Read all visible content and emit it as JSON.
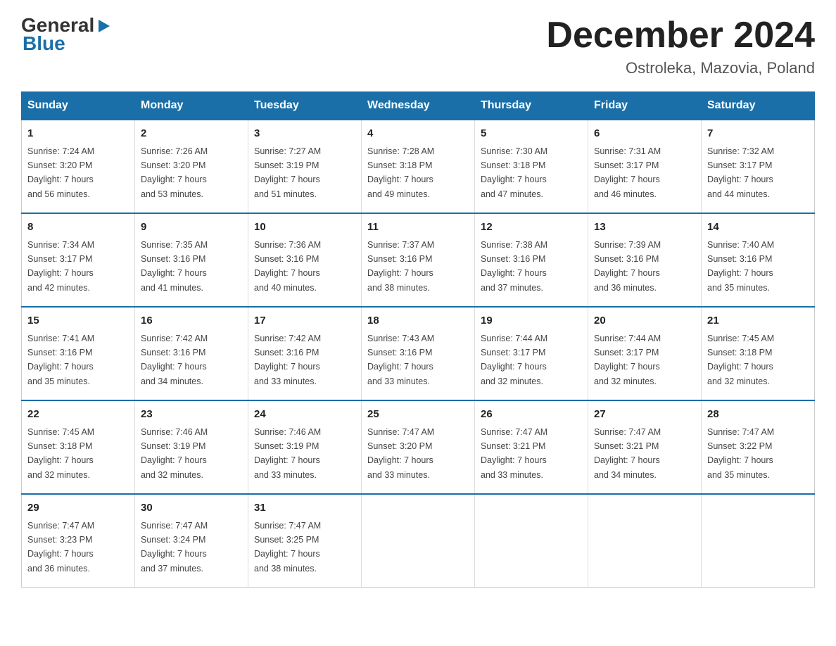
{
  "logo": {
    "general": "General",
    "blue": "Blue",
    "arrow": "▶"
  },
  "title": {
    "month_year": "December 2024",
    "location": "Ostroleka, Mazovia, Poland"
  },
  "columns": [
    "Sunday",
    "Monday",
    "Tuesday",
    "Wednesday",
    "Thursday",
    "Friday",
    "Saturday"
  ],
  "weeks": [
    [
      {
        "day": "1",
        "sunrise": "Sunrise: 7:24 AM",
        "sunset": "Sunset: 3:20 PM",
        "daylight": "Daylight: 7 hours",
        "minutes": "and 56 minutes."
      },
      {
        "day": "2",
        "sunrise": "Sunrise: 7:26 AM",
        "sunset": "Sunset: 3:20 PM",
        "daylight": "Daylight: 7 hours",
        "minutes": "and 53 minutes."
      },
      {
        "day": "3",
        "sunrise": "Sunrise: 7:27 AM",
        "sunset": "Sunset: 3:19 PM",
        "daylight": "Daylight: 7 hours",
        "minutes": "and 51 minutes."
      },
      {
        "day": "4",
        "sunrise": "Sunrise: 7:28 AM",
        "sunset": "Sunset: 3:18 PM",
        "daylight": "Daylight: 7 hours",
        "minutes": "and 49 minutes."
      },
      {
        "day": "5",
        "sunrise": "Sunrise: 7:30 AM",
        "sunset": "Sunset: 3:18 PM",
        "daylight": "Daylight: 7 hours",
        "minutes": "and 47 minutes."
      },
      {
        "day": "6",
        "sunrise": "Sunrise: 7:31 AM",
        "sunset": "Sunset: 3:17 PM",
        "daylight": "Daylight: 7 hours",
        "minutes": "and 46 minutes."
      },
      {
        "day": "7",
        "sunrise": "Sunrise: 7:32 AM",
        "sunset": "Sunset: 3:17 PM",
        "daylight": "Daylight: 7 hours",
        "minutes": "and 44 minutes."
      }
    ],
    [
      {
        "day": "8",
        "sunrise": "Sunrise: 7:34 AM",
        "sunset": "Sunset: 3:17 PM",
        "daylight": "Daylight: 7 hours",
        "minutes": "and 42 minutes."
      },
      {
        "day": "9",
        "sunrise": "Sunrise: 7:35 AM",
        "sunset": "Sunset: 3:16 PM",
        "daylight": "Daylight: 7 hours",
        "minutes": "and 41 minutes."
      },
      {
        "day": "10",
        "sunrise": "Sunrise: 7:36 AM",
        "sunset": "Sunset: 3:16 PM",
        "daylight": "Daylight: 7 hours",
        "minutes": "and 40 minutes."
      },
      {
        "day": "11",
        "sunrise": "Sunrise: 7:37 AM",
        "sunset": "Sunset: 3:16 PM",
        "daylight": "Daylight: 7 hours",
        "minutes": "and 38 minutes."
      },
      {
        "day": "12",
        "sunrise": "Sunrise: 7:38 AM",
        "sunset": "Sunset: 3:16 PM",
        "daylight": "Daylight: 7 hours",
        "minutes": "and 37 minutes."
      },
      {
        "day": "13",
        "sunrise": "Sunrise: 7:39 AM",
        "sunset": "Sunset: 3:16 PM",
        "daylight": "Daylight: 7 hours",
        "minutes": "and 36 minutes."
      },
      {
        "day": "14",
        "sunrise": "Sunrise: 7:40 AM",
        "sunset": "Sunset: 3:16 PM",
        "daylight": "Daylight: 7 hours",
        "minutes": "and 35 minutes."
      }
    ],
    [
      {
        "day": "15",
        "sunrise": "Sunrise: 7:41 AM",
        "sunset": "Sunset: 3:16 PM",
        "daylight": "Daylight: 7 hours",
        "minutes": "and 35 minutes."
      },
      {
        "day": "16",
        "sunrise": "Sunrise: 7:42 AM",
        "sunset": "Sunset: 3:16 PM",
        "daylight": "Daylight: 7 hours",
        "minutes": "and 34 minutes."
      },
      {
        "day": "17",
        "sunrise": "Sunrise: 7:42 AM",
        "sunset": "Sunset: 3:16 PM",
        "daylight": "Daylight: 7 hours",
        "minutes": "and 33 minutes."
      },
      {
        "day": "18",
        "sunrise": "Sunrise: 7:43 AM",
        "sunset": "Sunset: 3:16 PM",
        "daylight": "Daylight: 7 hours",
        "minutes": "and 33 minutes."
      },
      {
        "day": "19",
        "sunrise": "Sunrise: 7:44 AM",
        "sunset": "Sunset: 3:17 PM",
        "daylight": "Daylight: 7 hours",
        "minutes": "and 32 minutes."
      },
      {
        "day": "20",
        "sunrise": "Sunrise: 7:44 AM",
        "sunset": "Sunset: 3:17 PM",
        "daylight": "Daylight: 7 hours",
        "minutes": "and 32 minutes."
      },
      {
        "day": "21",
        "sunrise": "Sunrise: 7:45 AM",
        "sunset": "Sunset: 3:18 PM",
        "daylight": "Daylight: 7 hours",
        "minutes": "and 32 minutes."
      }
    ],
    [
      {
        "day": "22",
        "sunrise": "Sunrise: 7:45 AM",
        "sunset": "Sunset: 3:18 PM",
        "daylight": "Daylight: 7 hours",
        "minutes": "and 32 minutes."
      },
      {
        "day": "23",
        "sunrise": "Sunrise: 7:46 AM",
        "sunset": "Sunset: 3:19 PM",
        "daylight": "Daylight: 7 hours",
        "minutes": "and 32 minutes."
      },
      {
        "day": "24",
        "sunrise": "Sunrise: 7:46 AM",
        "sunset": "Sunset: 3:19 PM",
        "daylight": "Daylight: 7 hours",
        "minutes": "and 33 minutes."
      },
      {
        "day": "25",
        "sunrise": "Sunrise: 7:47 AM",
        "sunset": "Sunset: 3:20 PM",
        "daylight": "Daylight: 7 hours",
        "minutes": "and 33 minutes."
      },
      {
        "day": "26",
        "sunrise": "Sunrise: 7:47 AM",
        "sunset": "Sunset: 3:21 PM",
        "daylight": "Daylight: 7 hours",
        "minutes": "and 33 minutes."
      },
      {
        "day": "27",
        "sunrise": "Sunrise: 7:47 AM",
        "sunset": "Sunset: 3:21 PM",
        "daylight": "Daylight: 7 hours",
        "minutes": "and 34 minutes."
      },
      {
        "day": "28",
        "sunrise": "Sunrise: 7:47 AM",
        "sunset": "Sunset: 3:22 PM",
        "daylight": "Daylight: 7 hours",
        "minutes": "and 35 minutes."
      }
    ],
    [
      {
        "day": "29",
        "sunrise": "Sunrise: 7:47 AM",
        "sunset": "Sunset: 3:23 PM",
        "daylight": "Daylight: 7 hours",
        "minutes": "and 36 minutes."
      },
      {
        "day": "30",
        "sunrise": "Sunrise: 7:47 AM",
        "sunset": "Sunset: 3:24 PM",
        "daylight": "Daylight: 7 hours",
        "minutes": "and 37 minutes."
      },
      {
        "day": "31",
        "sunrise": "Sunrise: 7:47 AM",
        "sunset": "Sunset: 3:25 PM",
        "daylight": "Daylight: 7 hours",
        "minutes": "and 38 minutes."
      },
      {
        "day": "",
        "sunrise": "",
        "sunset": "",
        "daylight": "",
        "minutes": ""
      },
      {
        "day": "",
        "sunrise": "",
        "sunset": "",
        "daylight": "",
        "minutes": ""
      },
      {
        "day": "",
        "sunrise": "",
        "sunset": "",
        "daylight": "",
        "minutes": ""
      },
      {
        "day": "",
        "sunrise": "",
        "sunset": "",
        "daylight": "",
        "minutes": ""
      }
    ]
  ]
}
